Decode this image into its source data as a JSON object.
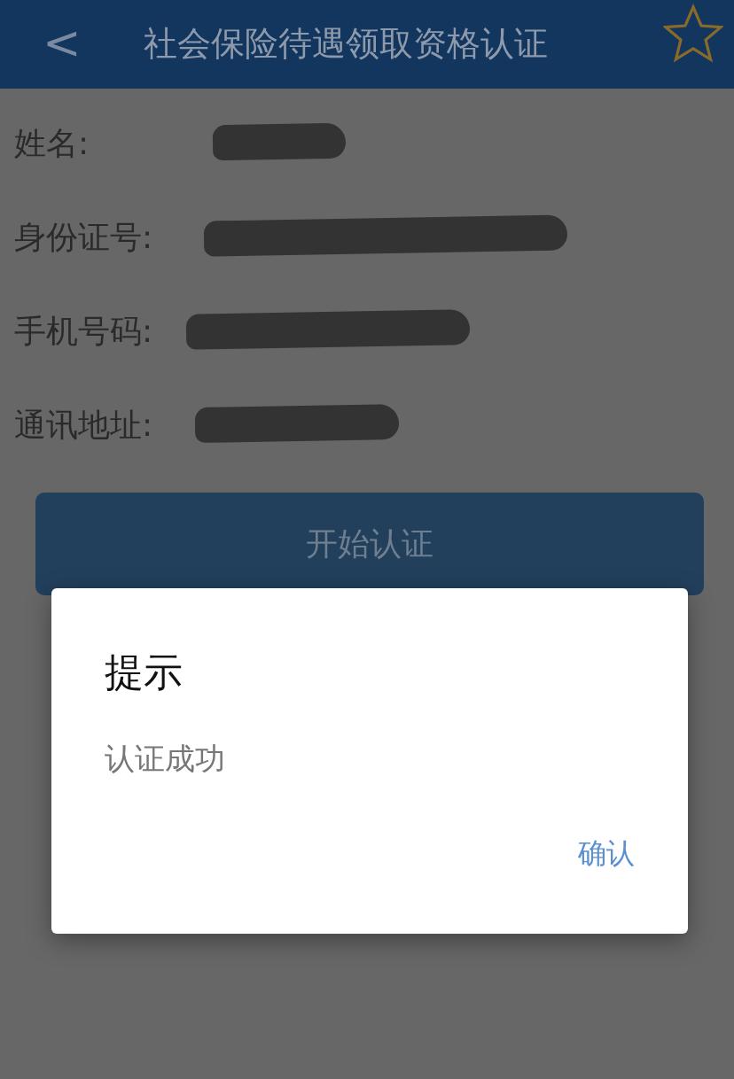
{
  "header": {
    "back": "<",
    "title": "社会保险待遇领取资格认证"
  },
  "fields": [
    {
      "label": "姓名:",
      "redacted": true
    },
    {
      "label": "身份证号:",
      "redacted": true
    },
    {
      "label": "手机号码:",
      "redacted": true
    },
    {
      "label": "通讯地址:",
      "redacted": true
    }
  ],
  "start_button": "开始认证",
  "dialog": {
    "title": "提示",
    "message": "认证成功",
    "confirm": "确认"
  }
}
